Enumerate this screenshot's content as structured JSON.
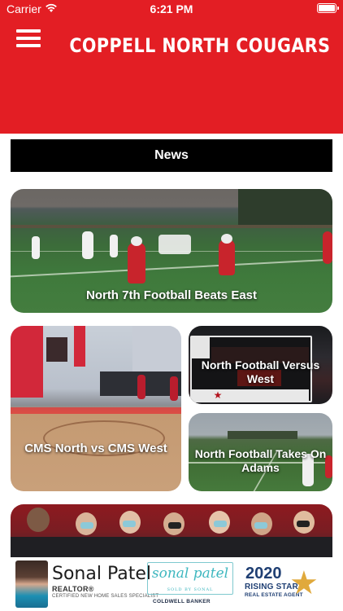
{
  "status_bar": {
    "carrier": "Carrier",
    "time": "6:21 PM",
    "wifi_icon": "wifi-icon",
    "battery_icon": "battery-icon"
  },
  "header": {
    "title": "COPPELL NORTH COUGARS",
    "menu_icon": "hamburger-menu-icon",
    "background_color": "#e31e24"
  },
  "section": {
    "label": "News"
  },
  "news": [
    {
      "headline": "North 7th Football Beats East"
    },
    {
      "headline": "CMS North vs CMS West"
    },
    {
      "headline": "North Football Versus West"
    },
    {
      "headline": "North Football Takes On Adams"
    },
    {
      "headline": ""
    }
  ],
  "ad": {
    "name": "Sonal Patel",
    "realtor": "REALTOR®",
    "tagline": "CERTIFIED NEW HOME SALES SPECIALIST",
    "script_logo": "sonal patel",
    "script_sub": "SOLD BY SONAL",
    "brokerage": "COLDWELL BANKER",
    "year": "2020",
    "award": "RISING STAR",
    "award_sub": "REAL ESTATE AGENT",
    "star_icon": "star-icon"
  }
}
